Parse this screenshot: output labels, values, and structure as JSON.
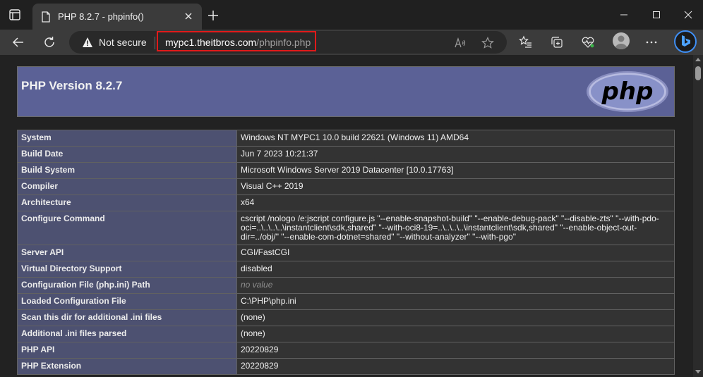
{
  "browser": {
    "tab": {
      "title": "PHP 8.2.7 - phpinfo()"
    },
    "address_bar": {
      "security_label": "Not secure",
      "url_host": "mypc1.theitbros.com",
      "url_path": "/phpinfo.php"
    },
    "colors": {
      "highlight_border": "#e01a1a",
      "accent": "#3f8ff5"
    },
    "icons": {
      "tab_actions": "tab-actions-icon",
      "new_tab": "plus-icon",
      "back": "back-arrow-icon",
      "refresh": "refresh-icon",
      "read_aloud": "read-aloud-icon",
      "favorite": "star-icon",
      "favorites_list": "favorites-icon",
      "collections": "collections-icon",
      "browser_essentials": "heart-pulse-icon",
      "profile": "avatar",
      "bing": "bing-chat-icon"
    }
  },
  "page": {
    "header_title": "PHP Version 8.2.7",
    "logo_text": "php",
    "colors": {
      "header_bg": "#5b6196",
      "label_bg": "#4d5171",
      "value_bg": "#333333"
    },
    "rows": [
      {
        "label": "System",
        "value": "Windows NT MYPC1 10.0 build 22621 (Windows 11) AMD64"
      },
      {
        "label": "Build Date",
        "value": "Jun 7 2023 10:21:37"
      },
      {
        "label": "Build System",
        "value": "Microsoft Windows Server 2019 Datacenter [10.0.17763]"
      },
      {
        "label": "Compiler",
        "value": "Visual C++ 2019"
      },
      {
        "label": "Architecture",
        "value": "x64"
      },
      {
        "label": "Configure Command",
        "value": "cscript /nologo /e:jscript configure.js \"--enable-snapshot-build\" \"--enable-debug-pack\" \"--disable-zts\" \"--with-pdo-oci=..\\..\\..\\..\\instantclient\\sdk,shared\" \"--with-oci8-19=..\\..\\..\\..\\instantclient\\sdk,shared\" \"--enable-object-out-dir=../obj/\" \"--enable-com-dotnet=shared\" \"--without-analyzer\" \"--with-pgo\""
      },
      {
        "label": "Server API",
        "value": "CGI/FastCGI"
      },
      {
        "label": "Virtual Directory Support",
        "value": "disabled"
      },
      {
        "label": "Configuration File (php.ini) Path",
        "value": "no value"
      },
      {
        "label": "Loaded Configuration File",
        "value": "C:\\PHP\\php.ini"
      },
      {
        "label": "Scan this dir for additional .ini files",
        "value": "(none)"
      },
      {
        "label": "Additional .ini files parsed",
        "value": "(none)"
      },
      {
        "label": "PHP API",
        "value": "20220829"
      },
      {
        "label": "PHP Extension",
        "value": "20220829"
      }
    ]
  }
}
